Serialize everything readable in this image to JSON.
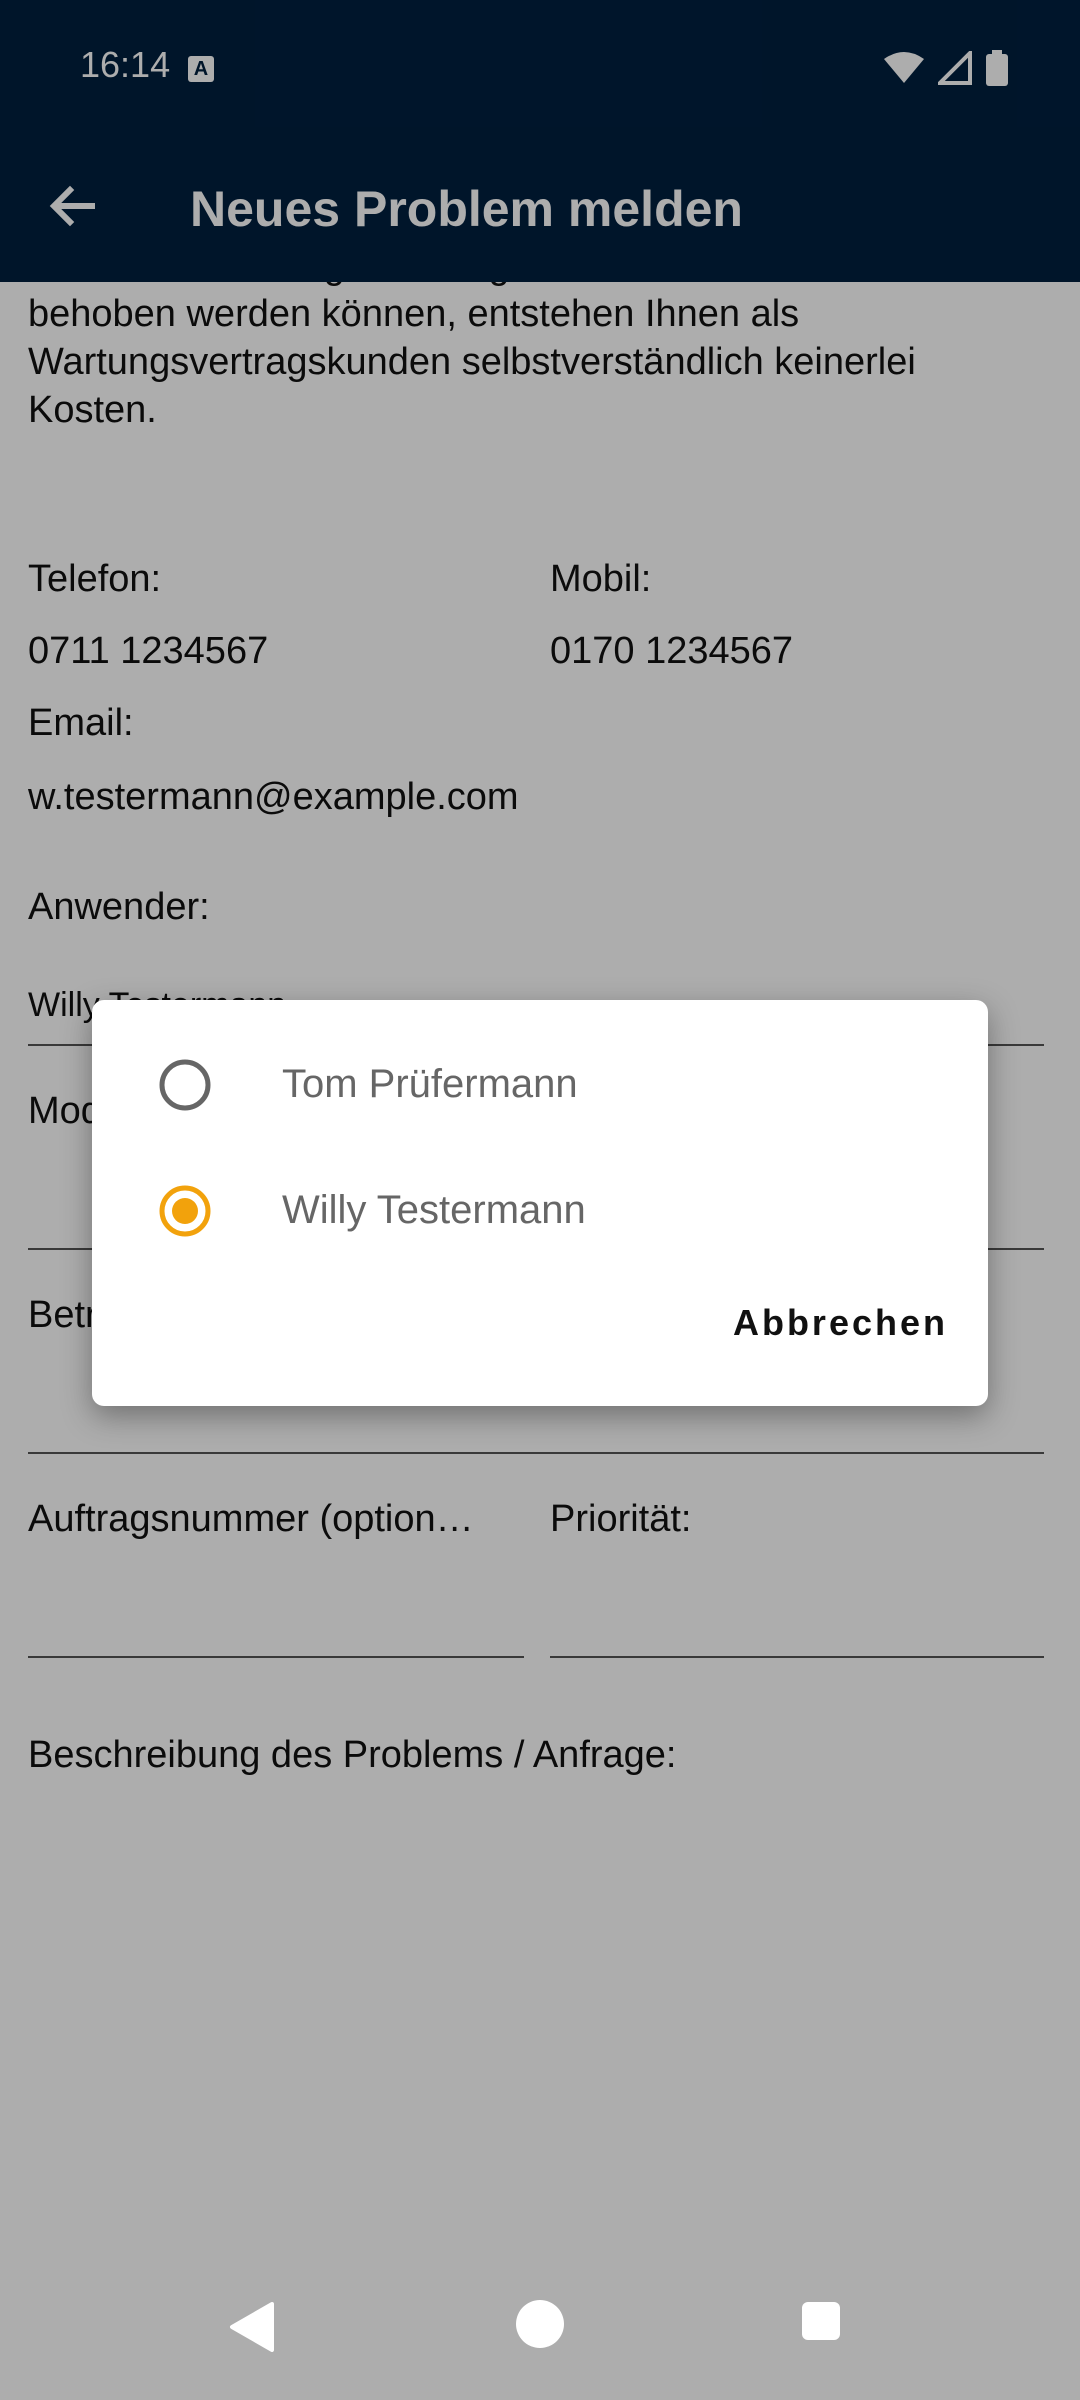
{
  "status_bar": {
    "time": "16:14",
    "a_badge": "A",
    "icons": [
      "wifi-icon",
      "signal-icon",
      "battery-icon"
    ]
  },
  "app_bar": {
    "title": "Neues Problem melden",
    "back_icon": "back-arrow-icon"
  },
  "intro_text": "oder der Änderung einer allgemeinen Formularfunktion behoben werden können, entstehen Ihnen als Wartungsvertragskunden selbstverständlich keinerlei Kosten.",
  "contact": {
    "telefon_label": "Telefon:",
    "telefon_value": "0711 1234567",
    "mobil_label": "Mobil:",
    "mobil_value": "0170 1234567",
    "email_label": "Email:",
    "email_value": "w.testermann@example.com"
  },
  "form": {
    "anwender_label": "Anwender:",
    "anwender_value": "Willy Testermann",
    "modul_label": "Modul:",
    "betreff_label": "Betreff:",
    "auftragsnummer_label": "Auftragsnummer (option…",
    "prioritaet_label": "Priorität:",
    "beschreibung_label": "Beschreibung des Problems / Anfrage:"
  },
  "dialog": {
    "options": [
      {
        "label": "Tom Prüfermann",
        "selected": false
      },
      {
        "label": "Willy Testermann",
        "selected": true
      }
    ],
    "cancel_label": "Abbrechen"
  },
  "colors": {
    "app_bar": "#001f3f",
    "accent": "#f2a20c"
  }
}
